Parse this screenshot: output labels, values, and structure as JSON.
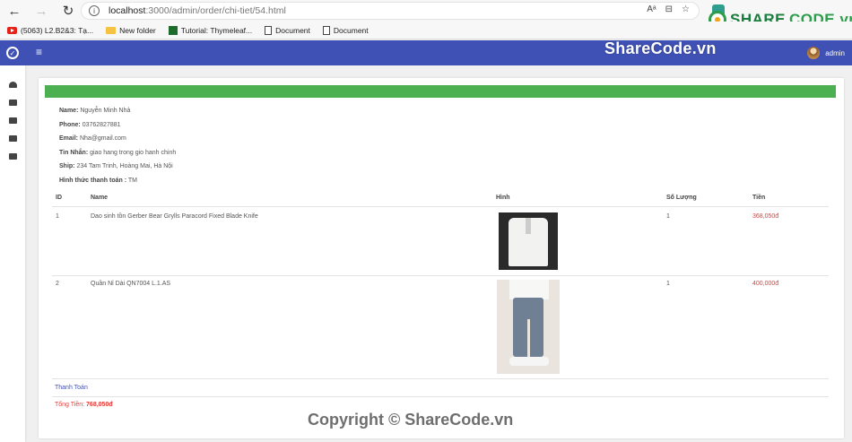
{
  "browser": {
    "url_host": "localhost",
    "url_path": ":3000/admin/order/chi-tiet/54.html",
    "bookmarks": [
      "(5063) L2.B2&3: Tạ...",
      "New folder",
      "Tutorial: Thymeleaf...",
      "Document",
      "Document"
    ]
  },
  "watermark": {
    "logo_share": "SHARE",
    "logo_code": "CODE.vn",
    "header": "ShareCode.vn",
    "footer": "Copyright © ShareCode.vn"
  },
  "header": {
    "menu_icon": "≡",
    "user": "admin"
  },
  "customer": {
    "name_label": "Name:",
    "name": "Nguyễn Minh Nhả",
    "phone_label": "Phone:",
    "phone": "03762827881",
    "email_label": "Email:",
    "email": "Nha@gmail.com",
    "message_label": "Tin Nhắn:",
    "message": "giao hang trong gio hanh chinh",
    "ship_label": "Ship:",
    "ship": "234 Tam Trinh, Hoàng Mai, Hà Nội",
    "payment_label": "Hình thức thanh toán :",
    "payment": "TM"
  },
  "table": {
    "headers": [
      "ID",
      "Name",
      "Hình",
      "Số Lượng",
      "Tiền"
    ],
    "rows": [
      {
        "id": "1",
        "name": "Dao sinh tồn Gerber Bear Grylls Paracord Fixed Blade Knife",
        "qty": "1",
        "price": "368,050đ"
      },
      {
        "id": "2",
        "name": "Quần Nỉ Dài QN7004 L.1.AS",
        "qty": "1",
        "price": "400,000đ"
      }
    ]
  },
  "footer": {
    "pay_link": "Thanh Toán",
    "total_label": "Tổng Tiền:",
    "total_value": "768,050đ"
  }
}
